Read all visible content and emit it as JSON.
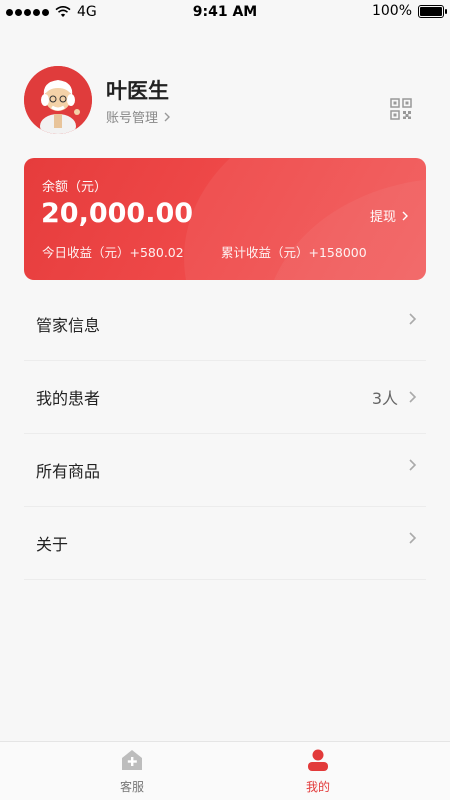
{
  "status": {
    "carrier": "4G",
    "time": "9:41 AM",
    "battery": "100%",
    "battery_level": 1.0
  },
  "profile": {
    "name": "叶医生",
    "account_link": "账号管理"
  },
  "wallet": {
    "balance_label": "余额（元）",
    "balance_value": "20,000.00",
    "withdraw": "提现",
    "today_income": "今日收益（元）+580.02",
    "total_income": "累计收益（元）+158000"
  },
  "menu": [
    {
      "label": "管家信息",
      "value": ""
    },
    {
      "label": "我的患者",
      "value": "3人"
    },
    {
      "label": "所有商品",
      "value": ""
    },
    {
      "label": "关于",
      "value": ""
    }
  ],
  "tabs": [
    {
      "label": "客服",
      "icon": "home-plus-icon"
    },
    {
      "label": "我的",
      "icon": "user-icon"
    }
  ],
  "colors": {
    "accent": "#e23a3a"
  }
}
